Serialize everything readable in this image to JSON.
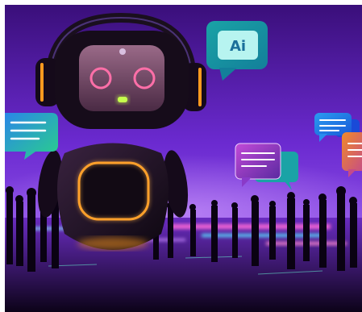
{
  "image": {
    "bubble_text": "Ai",
    "palette": {
      "frame": "#ffffff",
      "sky_top": "#4a1490",
      "sky_mid": "#6b2ad0",
      "floor": "#1a0630",
      "robot_body": "#1c1024",
      "robot_trim": "#ff9a1f",
      "eye_glow": "#ff6fa8",
      "mouth_glow": "#c6ff4d",
      "bubble_teal": "#1fa6a0",
      "bubble_blue": "#1f8fe0",
      "bubble_purple": "#a14ddb",
      "bubble_orange": "#e87a2b"
    },
    "icons": [
      "chat-bubble-icon",
      "text-lines-icon"
    ]
  }
}
